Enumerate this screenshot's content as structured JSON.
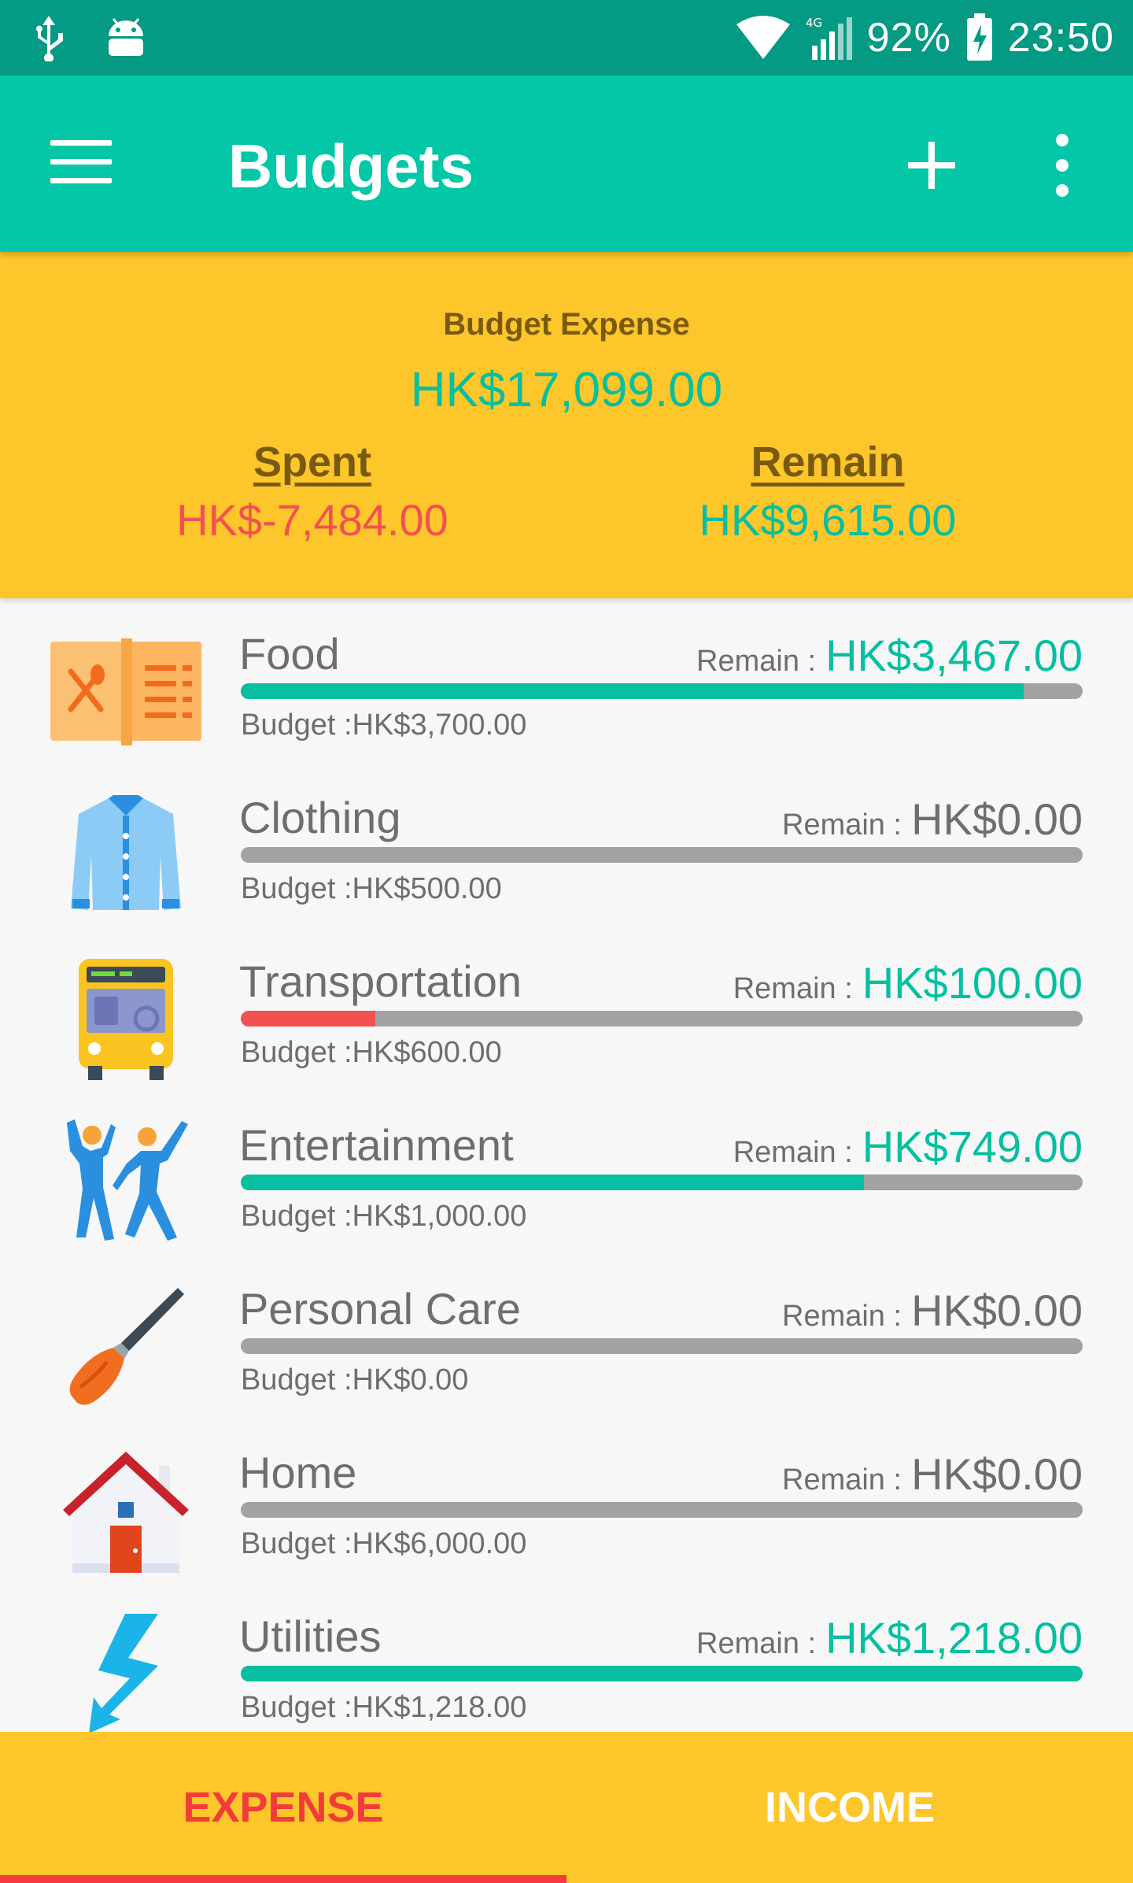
{
  "status_bar": {
    "battery": "92%",
    "time": "23:50",
    "network": "4G",
    "icons": [
      "usb-icon",
      "android-icon",
      "wifi-icon",
      "signal-icon",
      "battery-charging-icon"
    ]
  },
  "app_bar": {
    "title": "Budgets",
    "icons": [
      "menu-icon",
      "add-icon",
      "more-vert-icon"
    ]
  },
  "summary": {
    "label": "Budget Expense",
    "total": "HK$17,099.00",
    "spent_label": "Spent",
    "spent_value": "HK$-7,484.00",
    "remain_label": "Remain",
    "remain_value": "HK$9,615.00"
  },
  "colors": {
    "primary": "#03c7a6",
    "status_bar": "#049a83",
    "summary_bg": "#fdc62b",
    "positive": "#05bfa0",
    "negative": "#f25151",
    "neutral_text": "#6e6e6e",
    "bar_track": "#a2a2a2"
  },
  "budgets": [
    {
      "name": "Food",
      "remain_label": "Remain :",
      "remain": "HK$3,467.00",
      "remain_color": "#05bfa0",
      "budget": "Budget :HK$3,700.00",
      "progress": 0.93,
      "bar_color": "#05bfa0",
      "icon": "food-menu-icon"
    },
    {
      "name": "Clothing",
      "remain_label": "Remain :",
      "remain": "HK$0.00",
      "remain_color": "#6e6e6e",
      "budget": "Budget :HK$500.00",
      "progress": 0,
      "bar_color": "#05bfa0",
      "icon": "shirt-icon"
    },
    {
      "name": "Transportation",
      "remain_label": "Remain :",
      "remain": "HK$100.00",
      "remain_color": "#05bfa0",
      "budget": "Budget :HK$600.00",
      "progress": 0.16,
      "bar_color": "#f25151",
      "icon": "bus-icon"
    },
    {
      "name": "Entertainment",
      "remain_label": "Remain :",
      "remain": "HK$749.00",
      "remain_color": "#05bfa0",
      "budget": "Budget :HK$1,000.00",
      "progress": 0.74,
      "bar_color": "#05bfa0",
      "icon": "dancing-people-icon"
    },
    {
      "name": "Personal Care",
      "remain_label": "Remain :",
      "remain": "HK$0.00",
      "remain_color": "#6e6e6e",
      "budget": "Budget :HK$0.00",
      "progress": 0,
      "bar_color": "#05bfa0",
      "icon": "makeup-brush-icon"
    },
    {
      "name": "Home",
      "remain_label": "Remain :",
      "remain": "HK$0.00",
      "remain_color": "#6e6e6e",
      "budget": "Budget :HK$6,000.00",
      "progress": 0,
      "bar_color": "#05bfa0",
      "icon": "house-icon"
    },
    {
      "name": "Utilities",
      "remain_label": "Remain :",
      "remain": "HK$1,218.00",
      "remain_color": "#05bfa0",
      "budget": "Budget :HK$1,218.00",
      "progress": 1.0,
      "bar_color": "#05bfa0",
      "icon": "lightning-icon"
    }
  ],
  "tabs": [
    {
      "label": "EXPENSE",
      "active": true
    },
    {
      "label": "INCOME",
      "active": false
    }
  ]
}
